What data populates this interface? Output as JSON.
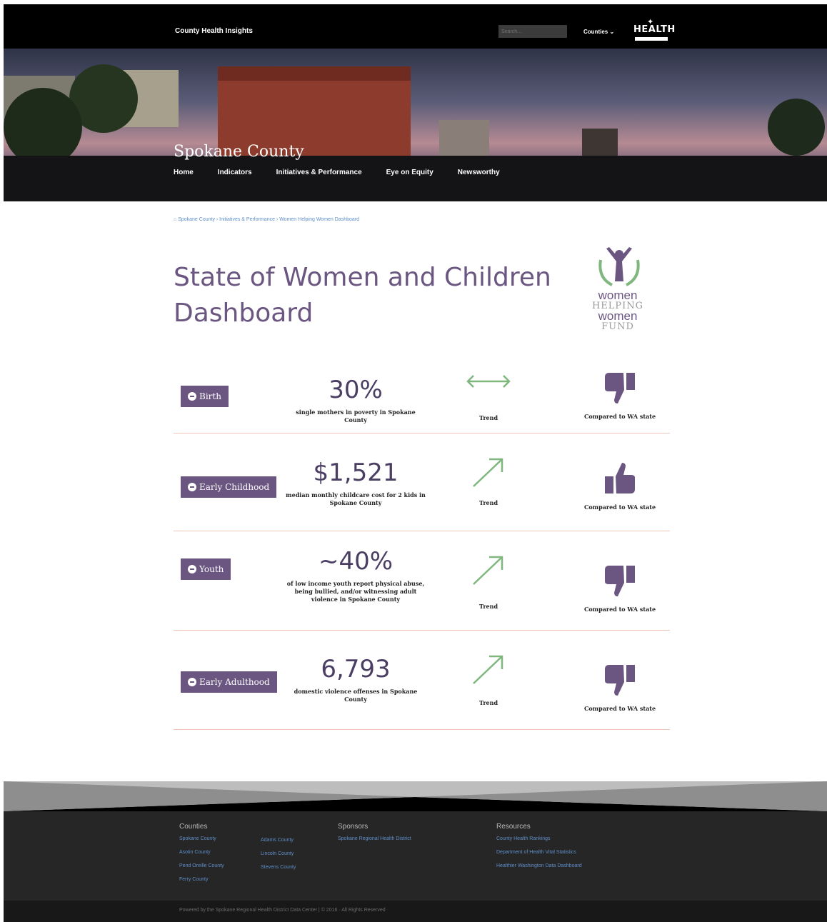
{
  "header": {
    "brand": "County Health Insights",
    "search_placeholder": "Search...",
    "counties_label": "Counties",
    "logo_text": "HEALTH"
  },
  "hero": {
    "county": "Spokane County",
    "nav": [
      "Home",
      "Indicators",
      "Initiatives & Performance",
      "Eye on Equity",
      "Newsworthy"
    ]
  },
  "breadcrumb": "Spokane County › Initiatives & Performance › Women Helping Women Dashboard",
  "page_title": "State of Women and Children Dashboard",
  "partner_logo": {
    "line1": "women",
    "line2": "HELPING",
    "line3": "women",
    "line4": "FUND"
  },
  "rows": [
    {
      "button": "Birth",
      "value": "30%",
      "desc": "single mothers in poverty in Spokane County",
      "trend": "flat",
      "trend_label": "Trend",
      "compare": "thumbs-down",
      "compare_label": "Compared to WA state"
    },
    {
      "button": "Early Childhood",
      "value": "$1,521",
      "desc": "median monthly childcare cost for 2 kids in Spokane County",
      "trend": "up",
      "trend_label": "Trend",
      "compare": "thumbs-up",
      "compare_label": "Compared to WA state"
    },
    {
      "button": "Youth",
      "value": "~40%",
      "desc": "of low income youth report physical abuse, being bullied, and/or witnessing adult violence in Spokane County",
      "trend": "up",
      "trend_label": "Trend",
      "compare": "thumbs-down",
      "compare_label": "Compared to WA state"
    },
    {
      "button": "Early Adulthood",
      "value": "6,793",
      "desc": "domestic violence offenses in Spokane County",
      "trend": "up",
      "trend_label": "Trend",
      "compare": "thumbs-down",
      "compare_label": "Compared to WA state"
    }
  ],
  "footer": {
    "counties_title": "Counties",
    "counties_col1": [
      "Spokane County",
      "Asotin County",
      "Pend Oreille County",
      "Ferry County"
    ],
    "counties_col2": [
      "Adams County",
      "Lincoln County",
      "Stevens County"
    ],
    "sponsors_title": "Sponsors",
    "sponsors": [
      "Spokane Regional Health District"
    ],
    "resources_title": "Resources",
    "resources": [
      "County Health Rankings",
      "Department of Health Vital Statistics",
      "Healthier Washington Data Dashboard"
    ],
    "copyright": "Powered by the Spokane Regional Health District Data Center | © 2016 · All Rights Reserved"
  },
  "colors": {
    "accent": "#6a5680",
    "trend": "#7fb77e",
    "footer": "#262626"
  }
}
